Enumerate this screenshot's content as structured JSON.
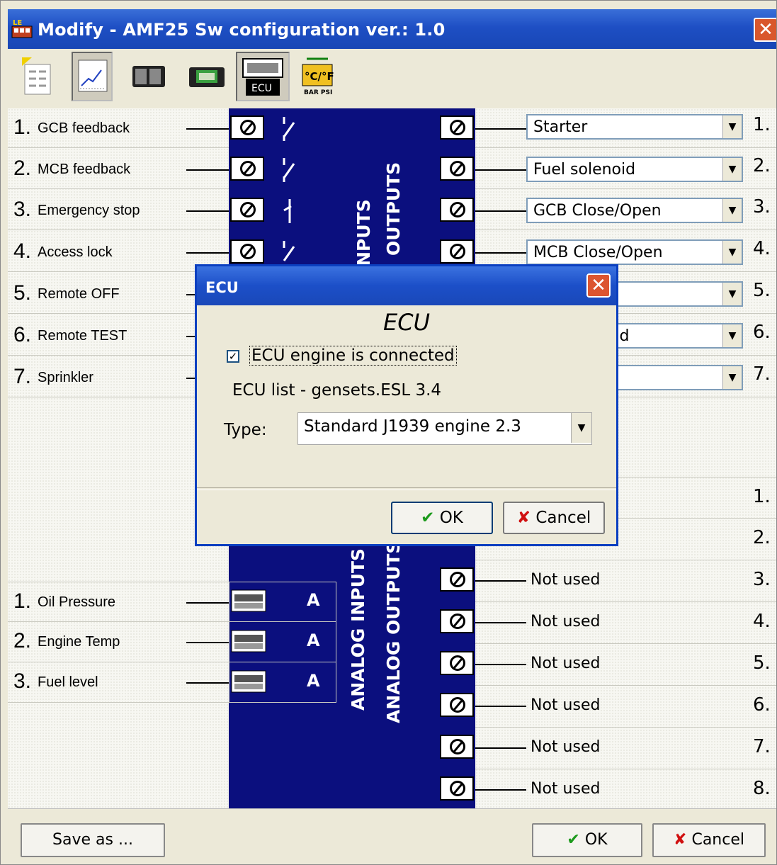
{
  "window": {
    "title": "Modify - AMF25  Sw configuration ver.: 1.0"
  },
  "toolbar": {
    "buttons": [
      "list-view-icon",
      "chart-icon",
      "panel-icon",
      "controller-icon",
      "ecu-icon",
      "units-icon"
    ]
  },
  "binary_inputs": [
    {
      "num": "1.",
      "label": "GCB feedback"
    },
    {
      "num": "2.",
      "label": "MCB feedback"
    },
    {
      "num": "3.",
      "label": "Emergency stop"
    },
    {
      "num": "4.",
      "label": "Access lock"
    },
    {
      "num": "5.",
      "label": "Remote OFF"
    },
    {
      "num": "6.",
      "label": "Remote TEST"
    },
    {
      "num": "7.",
      "label": "Sprinkler"
    }
  ],
  "binary_outputs": [
    {
      "num": "1.",
      "value": "Starter"
    },
    {
      "num": "2.",
      "value": "Fuel solenoid"
    },
    {
      "num": "3.",
      "value": "GCB Close/Open"
    },
    {
      "num": "4.",
      "value": "MCB Close/Open"
    },
    {
      "num": "5.",
      "value": ""
    },
    {
      "num": "6.",
      "value": "ad"
    },
    {
      "num": "7.",
      "value": ""
    }
  ],
  "analog_inputs": [
    {
      "num": "1.",
      "label": "Oil Pressure",
      "unit": "A"
    },
    {
      "num": "2.",
      "label": "Engine Temp",
      "unit": "A"
    },
    {
      "num": "3.",
      "label": "Fuel level",
      "unit": "A"
    }
  ],
  "analog_outputs": [
    {
      "num": "1.",
      "value": ""
    },
    {
      "num": "2.",
      "value": ""
    },
    {
      "num": "3.",
      "value": "Not used"
    },
    {
      "num": "4.",
      "value": "Not used"
    },
    {
      "num": "5.",
      "value": "Not used"
    },
    {
      "num": "6.",
      "value": "Not used"
    },
    {
      "num": "7.",
      "value": "Not used"
    },
    {
      "num": "8.",
      "value": "Not used"
    }
  ],
  "labels": {
    "binary_inputs_partial": "/ INPUTS",
    "binary_outputs": "OUTPUTS",
    "analog_inputs": "ANALOG INPUTS",
    "analog_outputs": "ANALOG OUTPUTS"
  },
  "footer": {
    "save_as": "Save as ...",
    "ok": "OK",
    "cancel": "Cancel"
  },
  "ecu_dialog": {
    "title": "ECU",
    "heading": "ECU",
    "checkbox_label": "ECU engine is connected",
    "checkbox_checked": true,
    "list_text": "ECU list - gensets.ESL 3.4",
    "type_label": "Type:",
    "type_value": "Standard J1939 engine 2.3",
    "ok": "OK",
    "cancel": "Cancel"
  }
}
